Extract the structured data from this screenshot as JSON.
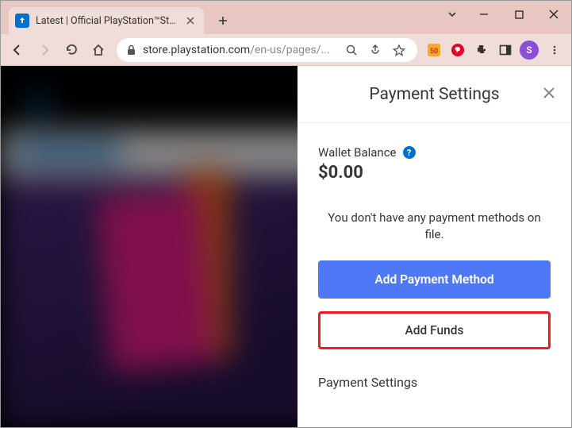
{
  "browser": {
    "tab_title": "Latest | Official PlayStation™Store",
    "url_host": "store.playstation.com",
    "url_path": "/en-us/pages/...",
    "profile_initial": "S"
  },
  "panel": {
    "title": "Payment Settings",
    "wallet_label": "Wallet Balance",
    "wallet_amount": "$0.00",
    "empty_message": "You don't have any payment methods on file.",
    "add_payment_label": "Add Payment Method",
    "add_funds_label": "Add Funds",
    "settings_link": "Payment Settings"
  }
}
